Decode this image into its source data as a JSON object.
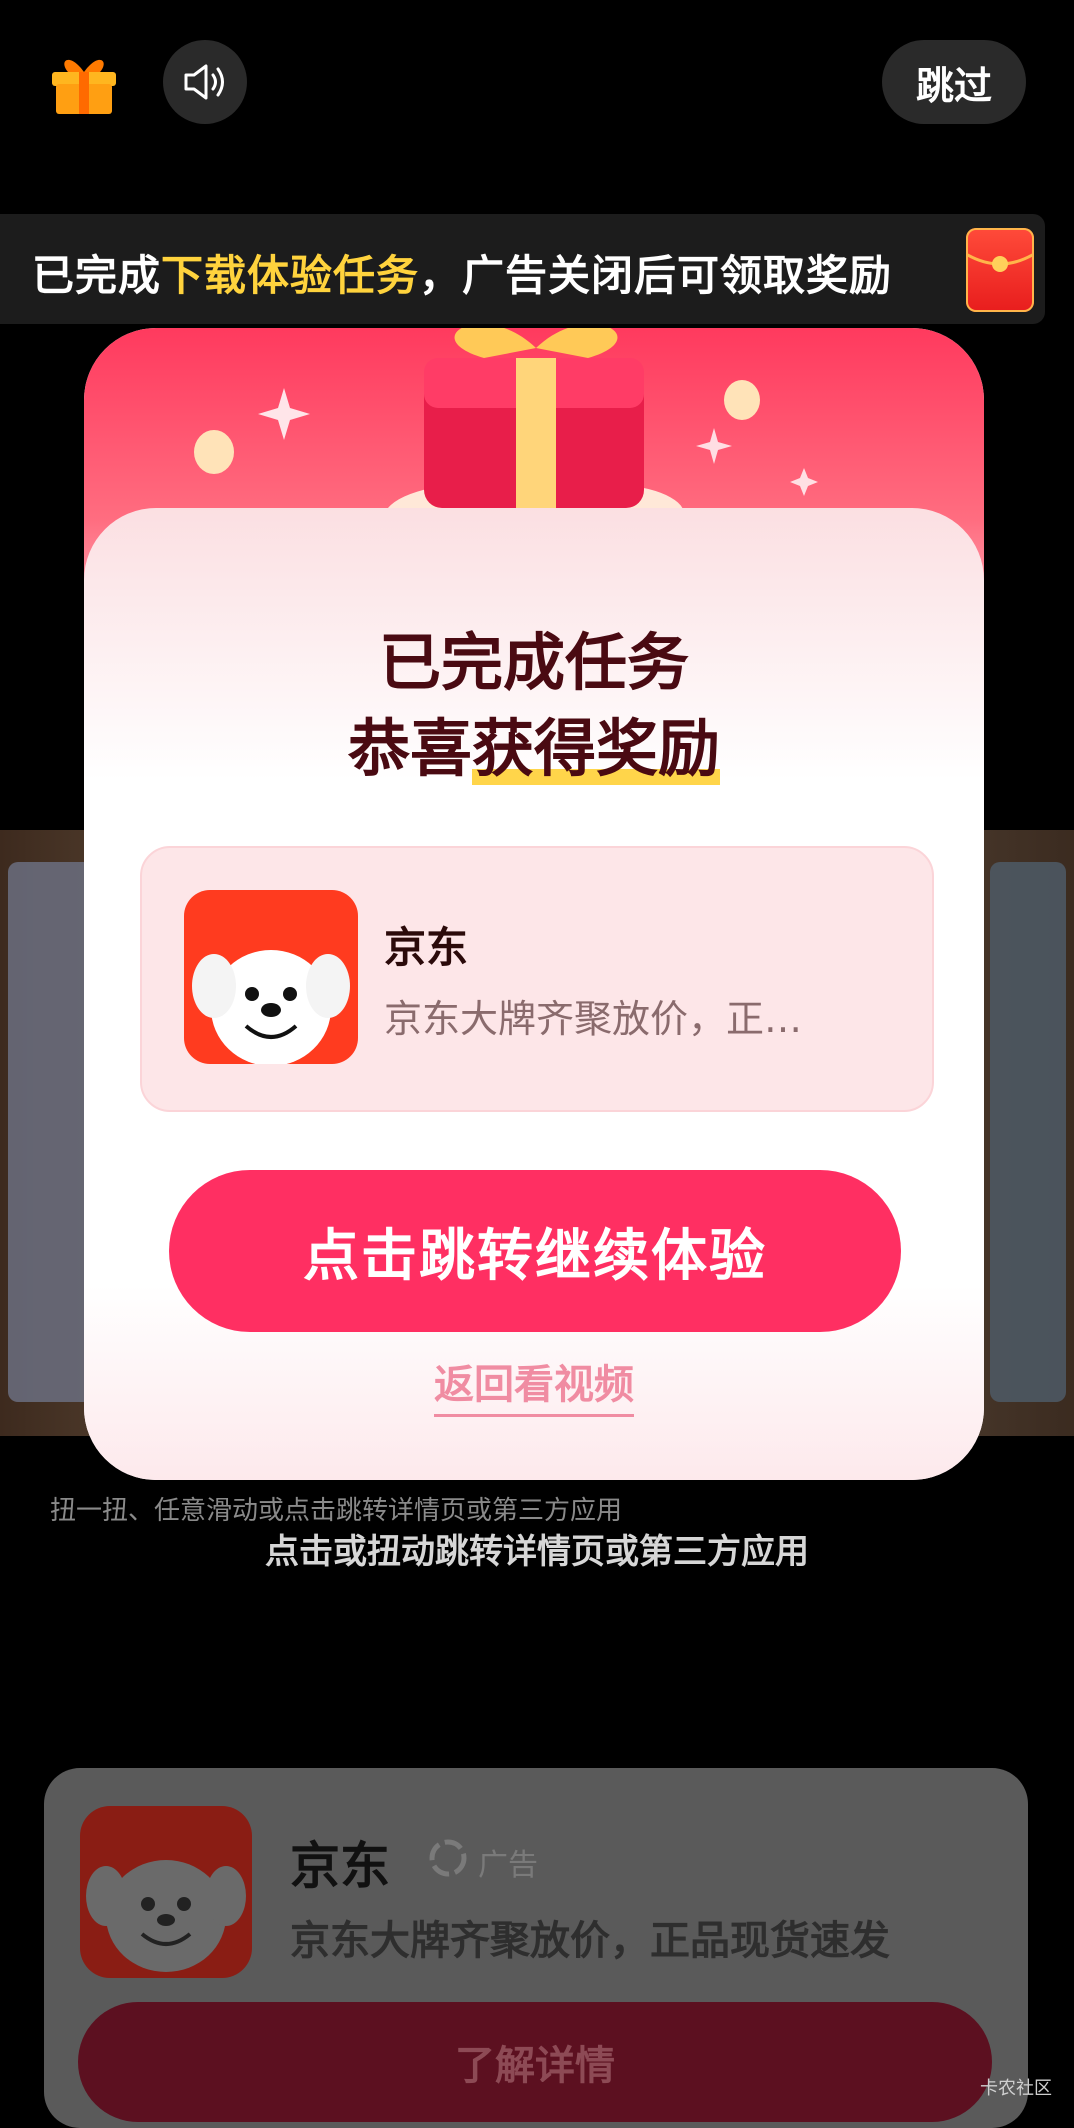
{
  "top_bar": {
    "skip_label": "跳过",
    "gift_icon": "gift-icon",
    "sound_icon": "speaker-icon"
  },
  "banner": {
    "text_prefix": "已完成",
    "text_highlight": "下载体验任务",
    "text_suffix": "，广告关闭后可领取奖励",
    "redpack_icon": "red-packet-icon",
    "highlight_color": "#ffd33d"
  },
  "modal": {
    "title_line1": "已完成任务",
    "title_line2_prefix": "恭喜",
    "title_line2_highlight": "获得奖励",
    "app": {
      "name": "京东",
      "description": "京东大牌齐聚放价，正…"
    },
    "cta_label": "点击跳转继续体验",
    "back_label": "返回看视频",
    "accent_color": "#ff2f62"
  },
  "background": {
    "sub_text": "扭一扭、任意滑动或点击跳转详情页或第三方应用",
    "main_text": "点击或扭动跳转详情页或第三方应用"
  },
  "bottom_card": {
    "title": "京东",
    "ad_label": "广告",
    "description": "京东大牌齐聚放价，正品现货速发",
    "button_label": "了解详情"
  },
  "watermark": "卡农社区"
}
